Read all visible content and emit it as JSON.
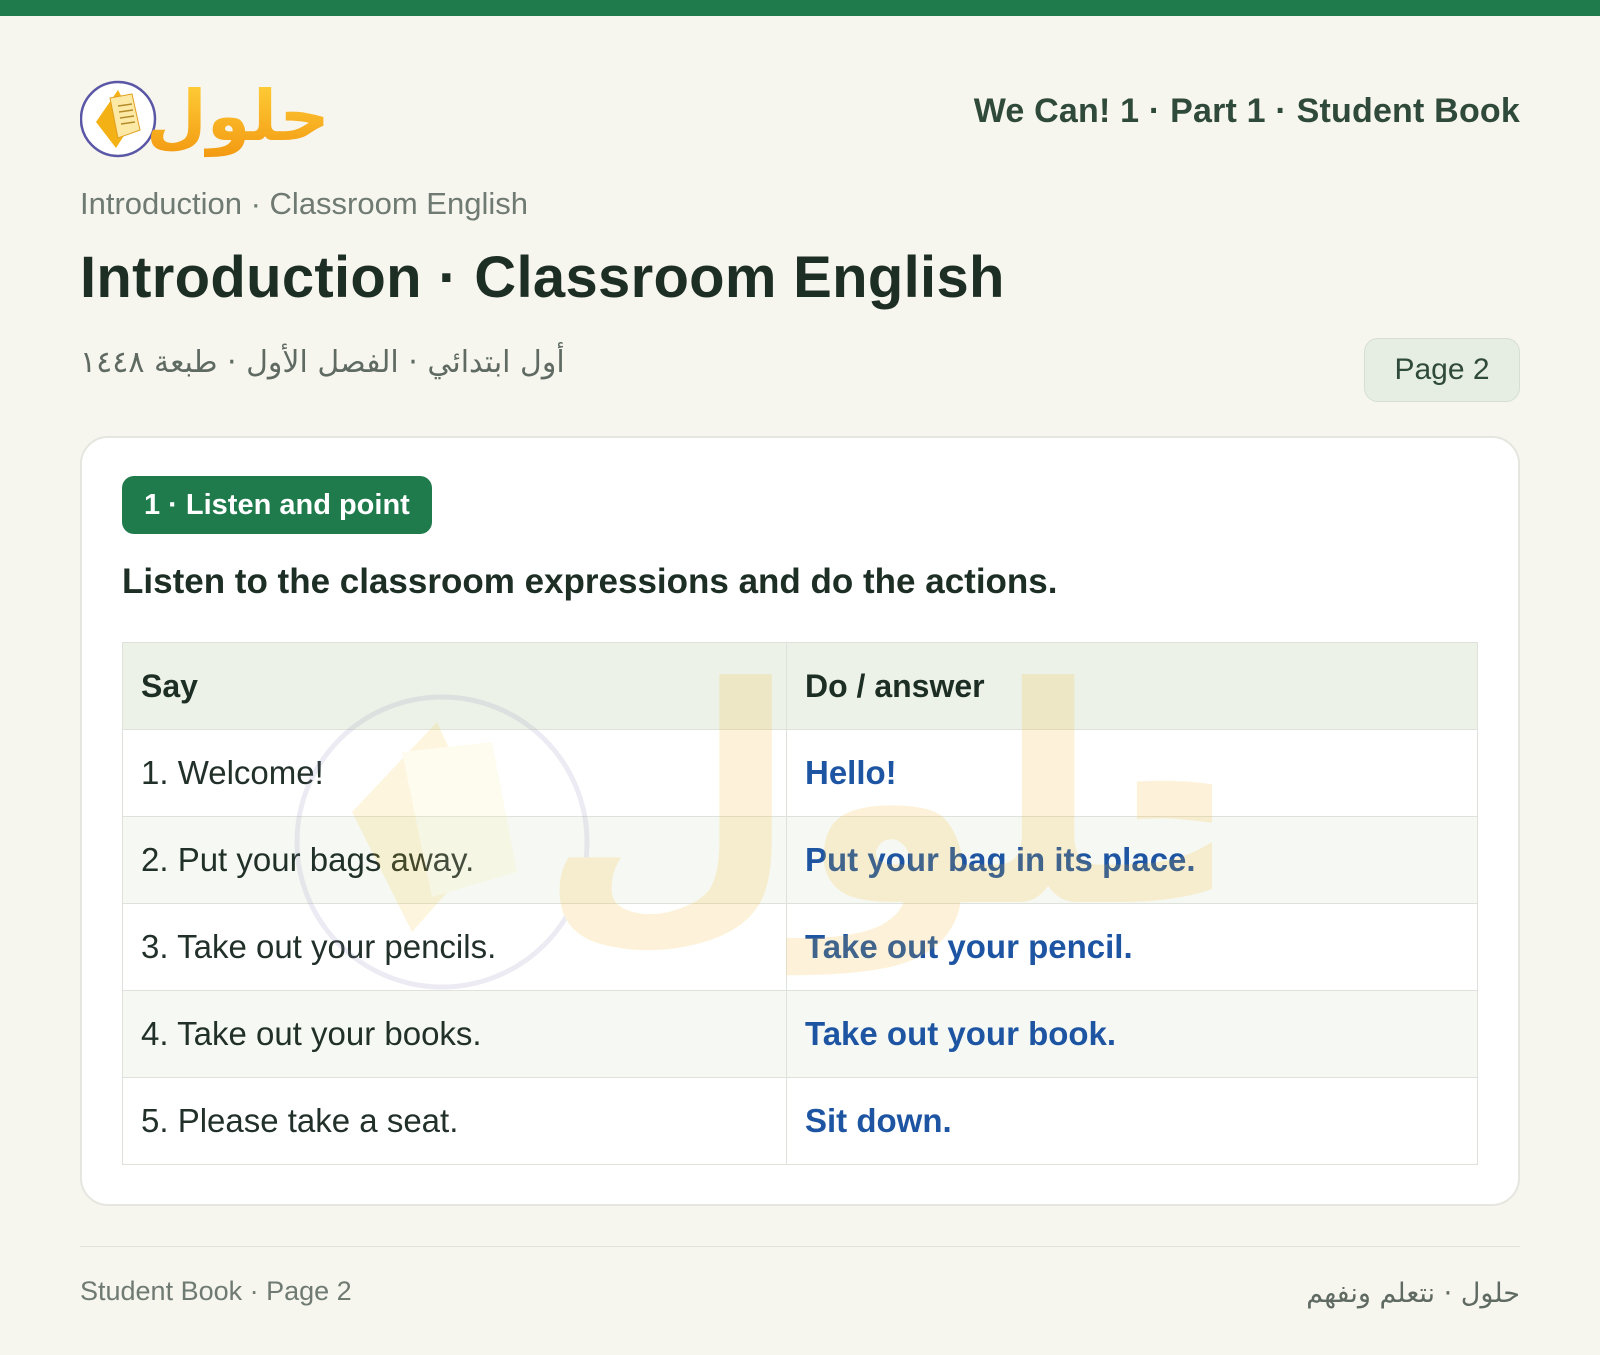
{
  "header": {
    "logo_text": "حلول",
    "book_title": "We Can! 1 · Part 1 · Student Book"
  },
  "breadcrumb": "Introduction · Classroom English",
  "page_title": "Introduction · Classroom English",
  "meta": "أول ابتدائي · الفصل الأول · طبعة ١٤٤٨",
  "page_badge": "Page 2",
  "section": {
    "label": "1 · Listen and point",
    "instruction": "Listen to the classroom expressions and do the actions."
  },
  "table": {
    "headers": [
      "Say",
      "Do / answer"
    ],
    "rows": [
      {
        "say": "1. Welcome!",
        "answer": "Hello!"
      },
      {
        "say": "2. Put your bags away.",
        "answer": "Put your bag in its place."
      },
      {
        "say": "3. Take out your pencils.",
        "answer": "Take out your pencil."
      },
      {
        "say": "4. Take out your books.",
        "answer": "Take out your book."
      },
      {
        "say": "5. Please take a seat.",
        "answer": "Sit down."
      }
    ]
  },
  "footer": {
    "left": "Student Book · Page 2",
    "right": "حلول · نتعلم ونفهم"
  },
  "colors": {
    "brand_green": "#1f7a4c",
    "answer_blue": "#1e55a3",
    "logo_orange": "#f3a21a",
    "background": "#f6f5ee"
  }
}
